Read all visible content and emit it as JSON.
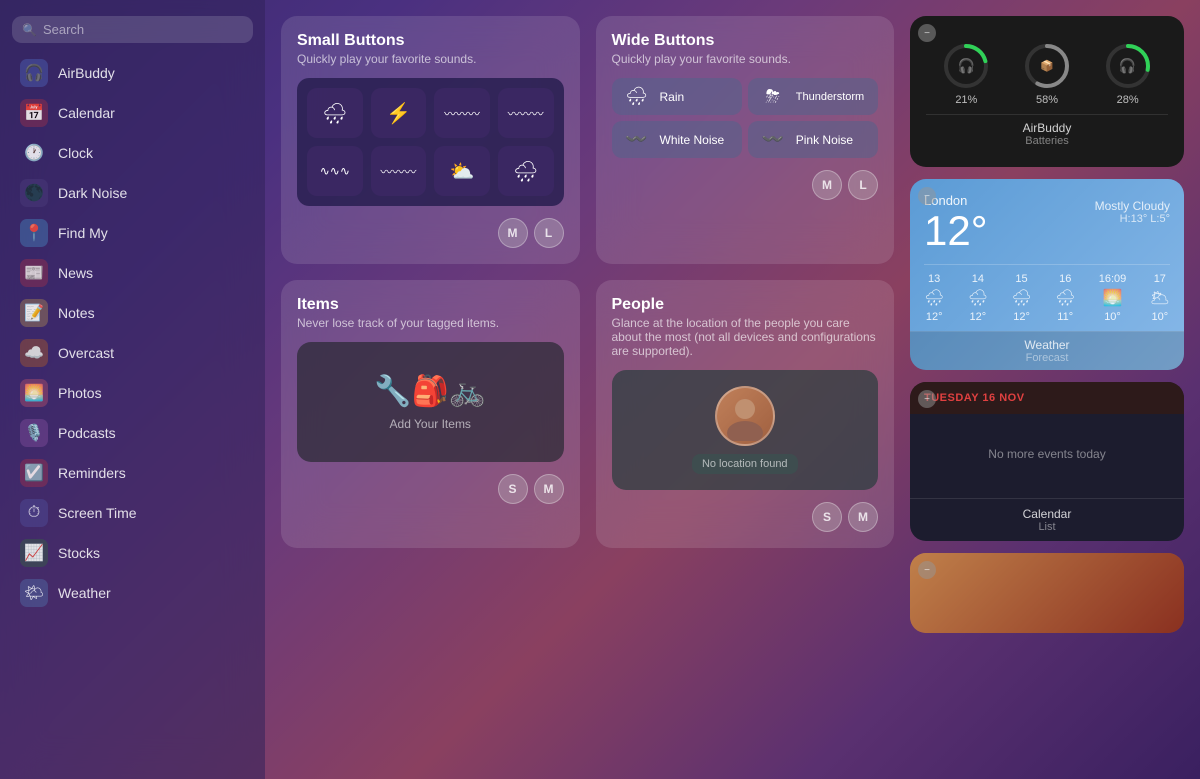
{
  "sidebar": {
    "search_placeholder": "Search",
    "items": [
      {
        "id": "airbuddy",
        "label": "AirBuddy",
        "emoji": "🎧",
        "color": "#5e8df5"
      },
      {
        "id": "calendar",
        "label": "Calendar",
        "emoji": "📅",
        "color": "#e03a3a"
      },
      {
        "id": "clock",
        "label": "Clock",
        "emoji": "🕐",
        "color": "#888"
      },
      {
        "id": "dark-noise",
        "label": "Dark Noise",
        "emoji": "🌑",
        "color": "#5a4a8a"
      },
      {
        "id": "find-my",
        "label": "Find My",
        "emoji": "📍",
        "color": "#4fc3f7"
      },
      {
        "id": "news",
        "label": "News",
        "emoji": "📰",
        "color": "#e03a3a"
      },
      {
        "id": "notes",
        "label": "Notes",
        "emoji": "📝",
        "color": "#f5c842"
      },
      {
        "id": "overcast",
        "label": "Overcast",
        "emoji": "☁️",
        "color": "#f57c00"
      },
      {
        "id": "photos",
        "label": "Photos",
        "emoji": "🌅",
        "color": "#ff6b6b"
      },
      {
        "id": "podcasts",
        "label": "Podcasts",
        "emoji": "🎙️",
        "color": "#b06abf"
      },
      {
        "id": "reminders",
        "label": "Reminders",
        "emoji": "☑️",
        "color": "#e03a3a"
      },
      {
        "id": "screen-time",
        "label": "Screen Time",
        "emoji": "⏱",
        "color": "#5a6abf"
      },
      {
        "id": "stocks",
        "label": "Stocks",
        "emoji": "📈",
        "color": "#2d8a2d"
      },
      {
        "id": "weather",
        "label": "Weather",
        "emoji": "🌤",
        "color": "#5a9fd4"
      }
    ]
  },
  "widgets": {
    "small_buttons": {
      "title": "Small Buttons",
      "subtitle": "Quickly play your favorite sounds.",
      "avatar_left": "M",
      "avatar_right": "L"
    },
    "wide_buttons": {
      "title": "Wide Buttons",
      "subtitle": "Quickly play your favorite sounds.",
      "buttons": [
        {
          "icon": "🌧",
          "label": "Rain"
        },
        {
          "icon": "⛈",
          "label": "Thunderstorm"
        },
        {
          "icon": "〰️",
          "label": "White Noise"
        },
        {
          "icon": "〰️",
          "label": "Pink Noise"
        }
      ],
      "avatar_left": "M",
      "avatar_right": "L"
    },
    "items": {
      "title": "Items",
      "subtitle": "Never lose track of your tagged items.",
      "preview_label": "Add Your Items",
      "icons": "🔧🎒🚲",
      "avatar_left": "S",
      "avatar_right": "M"
    },
    "people": {
      "title": "People",
      "subtitle": "Glance at the location of the people you care about the most (not all devices and configurations are supported).",
      "no_location_label": "No location found",
      "avatar_left": "S",
      "avatar_right": "M"
    }
  },
  "right_panel": {
    "airbuddy": {
      "circles": [
        {
          "pct": 21,
          "icon": "🎧",
          "color": "#30d158",
          "dash": 26
        },
        {
          "pct": 58,
          "icon": "📦",
          "color": "#888888",
          "dash": 73
        },
        {
          "pct": 28,
          "icon": "🎧",
          "color": "#30d158",
          "dash": 35
        }
      ],
      "app_name": "AirBuddy",
      "sub_label": "Batteries"
    },
    "weather": {
      "city": "London",
      "temp": "12°",
      "condition": "Mostly Cloudy",
      "high": "H:13°",
      "low": "L:5°",
      "forecast": [
        {
          "day": "13",
          "icon": "🌧",
          "temp": "12°"
        },
        {
          "day": "14",
          "icon": "🌧",
          "temp": "12°"
        },
        {
          "day": "15",
          "icon": "🌧",
          "temp": "12°"
        },
        {
          "day": "16",
          "icon": "🌧",
          "temp": "11°"
        },
        {
          "day": "16:09",
          "icon": "🌅",
          "temp": "10°"
        },
        {
          "day": "17",
          "icon": "🌥",
          "temp": "10°"
        }
      ],
      "app_name": "Weather",
      "sub_label": "Forecast"
    },
    "calendar": {
      "date_label": "TUESDAY 16 NOV",
      "no_events": "No more events today",
      "app_name": "Calendar",
      "sub_label": "List"
    }
  }
}
